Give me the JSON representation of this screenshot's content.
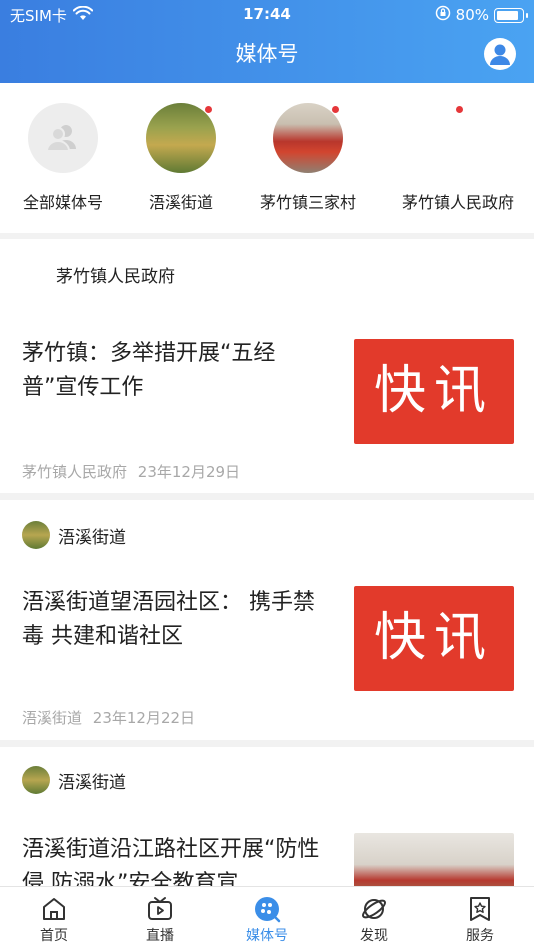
{
  "status": {
    "carrier": "无SIM卡",
    "time": "17:44",
    "battery": "80%",
    "battery_level": 0.8
  },
  "header": {
    "title": "媒体号"
  },
  "media": [
    {
      "label": "全部媒体号",
      "has_dot": false
    },
    {
      "label": "浯溪街道",
      "has_dot": true
    },
    {
      "label": "茅竹镇三家村",
      "has_dot": true
    },
    {
      "label": "茅竹镇人民政府",
      "has_dot": true
    }
  ],
  "articles": [
    {
      "source": "茅竹镇人民政府",
      "title": "茅竹镇：多举措开展“五经普”宣传工作",
      "meta_source": "茅竹镇人民政府",
      "date": "23年12月29日",
      "thumb_text": "快讯"
    },
    {
      "source": "浯溪街道",
      "title": "浯溪街道望浯园社区： 携手禁毒 共建和谐社区",
      "meta_source": "浯溪街道",
      "date": "23年12月22日",
      "thumb_text": "快讯"
    },
    {
      "source": "浯溪街道",
      "title": "浯溪街道沿江路社区开展“防性侵 防溺水”安全教育宣"
    }
  ],
  "tabs": [
    {
      "label": "首页",
      "icon": "home-icon"
    },
    {
      "label": "直播",
      "icon": "tv-icon"
    },
    {
      "label": "媒体号",
      "icon": "media-icon",
      "active": true
    },
    {
      "label": "发现",
      "icon": "planet-icon"
    },
    {
      "label": "服务",
      "icon": "bookmark-star-icon"
    }
  ],
  "colors": {
    "accent": "#3b8ee8",
    "header_start": "#3a7ee0",
    "header_end": "#4aa3f2",
    "badge": "#e5373a",
    "thumb_red": "#e23a2b"
  }
}
